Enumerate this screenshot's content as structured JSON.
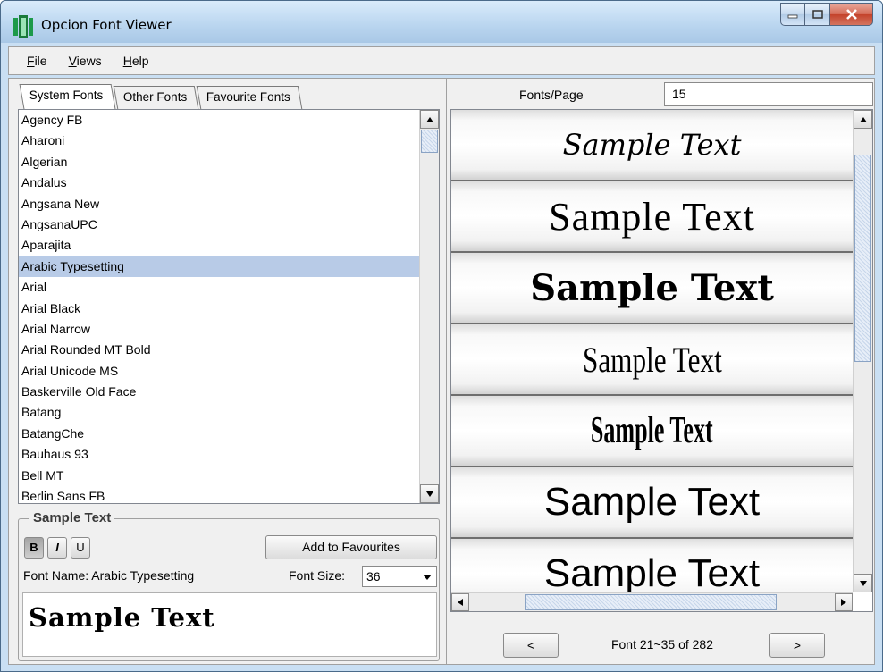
{
  "window": {
    "title": "Opcion Font Viewer"
  },
  "menu": {
    "items": [
      {
        "label": "File",
        "key": "F",
        "rest": "ile"
      },
      {
        "label": "Views",
        "key": "V",
        "rest": "iews"
      },
      {
        "label": "Help",
        "key": "H",
        "rest": "elp"
      }
    ]
  },
  "tabs": [
    "System Fonts",
    "Other Fonts",
    "Favourite Fonts"
  ],
  "font_list": {
    "selected": "Arabic Typesetting",
    "items": [
      "Agency FB",
      "Aharoni",
      "Algerian",
      "Andalus",
      "Angsana New",
      "AngsanaUPC",
      "Aparajita",
      "Arabic Typesetting",
      "Arial",
      "Arial Black",
      "Arial Narrow",
      "Arial Rounded MT Bold",
      "Arial Unicode MS",
      "Baskerville Old Face",
      "Batang",
      "BatangChe",
      "Bauhaus 93",
      "Bell MT",
      "Berlin Sans FB"
    ]
  },
  "sample_panel": {
    "legend": "Sample Text",
    "bold_label": "B",
    "italic_label": "I",
    "underline_label": "U",
    "add_favourites_label": "Add to Favourites",
    "font_name_label": "Font Name:  Arabic Typesetting",
    "font_size_label": "Font Size:",
    "font_size_value": "36",
    "preview_text": "Sample Text"
  },
  "viewer": {
    "fonts_per_page_label": "Fonts/Page",
    "fonts_per_page_value": "15",
    "samples": [
      "Sample Text",
      "Sample Text",
      "Sample Text",
      "Sample Text",
      "Sample Text",
      "Sample Text",
      "Sample Text"
    ],
    "prev_label": "<",
    "next_label": ">",
    "page_info": "Font 21~35 of 282"
  }
}
